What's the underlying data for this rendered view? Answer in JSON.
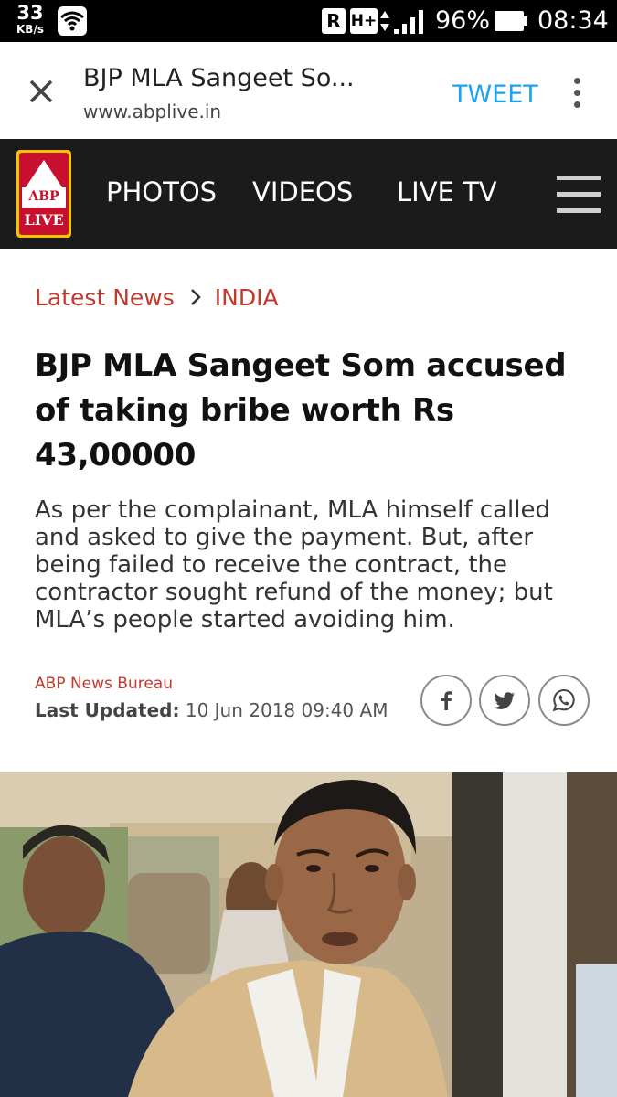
{
  "status_bar": {
    "net_speed": "33",
    "net_speed_unit": "KB/s",
    "r_badge": "R",
    "network_type": "H+",
    "battery": "96%",
    "time": "08:34"
  },
  "browser": {
    "page_title": "BJP MLA Sangeet So...",
    "url": "www.abplive.in",
    "tweet_label": "TWEET",
    "icons": [
      "close-icon",
      "more-vertical-icon"
    ]
  },
  "site_nav": {
    "logo_top": "ABP",
    "logo_bottom": "LIVE",
    "items": [
      {
        "label": "PHOTOS"
      },
      {
        "label": "VIDEOS"
      },
      {
        "label": "LIVE TV"
      }
    ],
    "menu_icon": "hamburger-icon"
  },
  "breadcrumb": {
    "section": "Latest News",
    "subsection": "INDIA",
    "separator_icon": "chevron-right-icon"
  },
  "article": {
    "headline": "BJP MLA Sangeet Som accused of taking bribe worth Rs 43,00000",
    "summary": "As per the complainant, MLA himself called and asked to give the payment. But, after being failed to receive the contract, the contractor sought refund of the money; but MLA’s people started avoiding him.",
    "author": "ABP News Bureau",
    "updated_label": "Last Updated:",
    "updated_value": "10 Jun 2018 09:40 AM"
  },
  "share": [
    "facebook-icon",
    "twitter-icon",
    "whatsapp-icon"
  ],
  "colors": {
    "accent_red": "#c0392b",
    "tweet_blue": "#1da1f2",
    "nav_bg": "#1b1b1b"
  }
}
